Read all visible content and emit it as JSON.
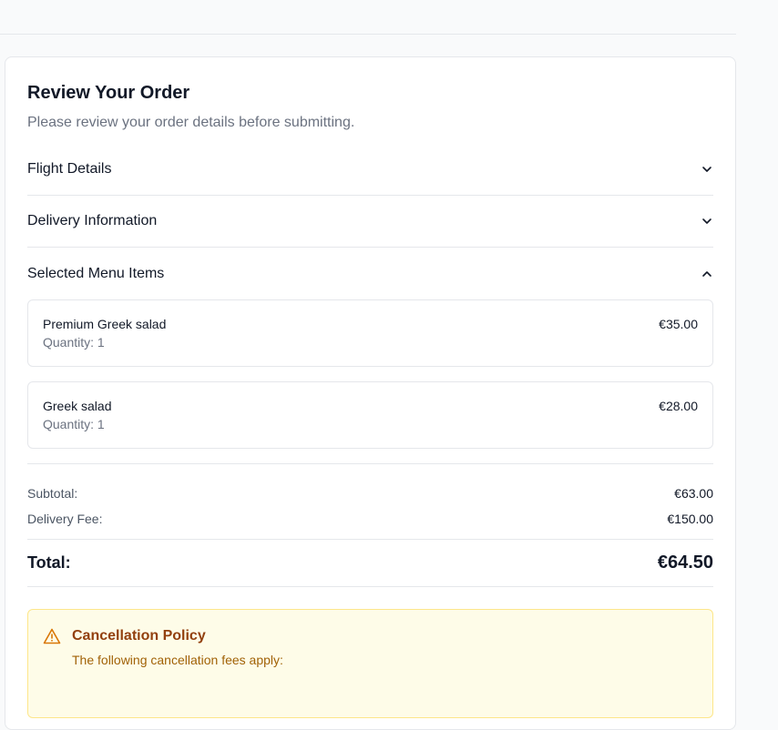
{
  "header": {
    "title": "Review Your Order",
    "subtitle": "Please review your order details before submitting."
  },
  "sections": {
    "flight": {
      "label": "Flight Details",
      "icon": "chevron-down-icon"
    },
    "delivery": {
      "label": "Delivery Information",
      "icon": "chevron-down-icon"
    },
    "menu": {
      "label": "Selected Menu Items",
      "icon": "chevron-up-icon"
    }
  },
  "menu_items": [
    {
      "name": "Premium Greek salad",
      "quantity": "Quantity: 1",
      "price": "€35.00"
    },
    {
      "name": "Greek salad",
      "quantity": "Quantity: 1",
      "price": "€28.00"
    }
  ],
  "totals": {
    "subtotal_label": "Subtotal:",
    "subtotal_value": "€63.00",
    "delivery_fee_label": "Delivery Fee:",
    "delivery_fee_value": "€150.00",
    "total_label": "Total:",
    "total_value": "€64.50"
  },
  "policy": {
    "icon": "warning-icon",
    "title": "Cancellation Policy",
    "text": "The following cancellation fees apply:"
  },
  "colors": {
    "accent_warning": "#d97706",
    "warning_bg": "#fefce8",
    "text_primary": "#111827",
    "text_muted": "#6b7280"
  }
}
